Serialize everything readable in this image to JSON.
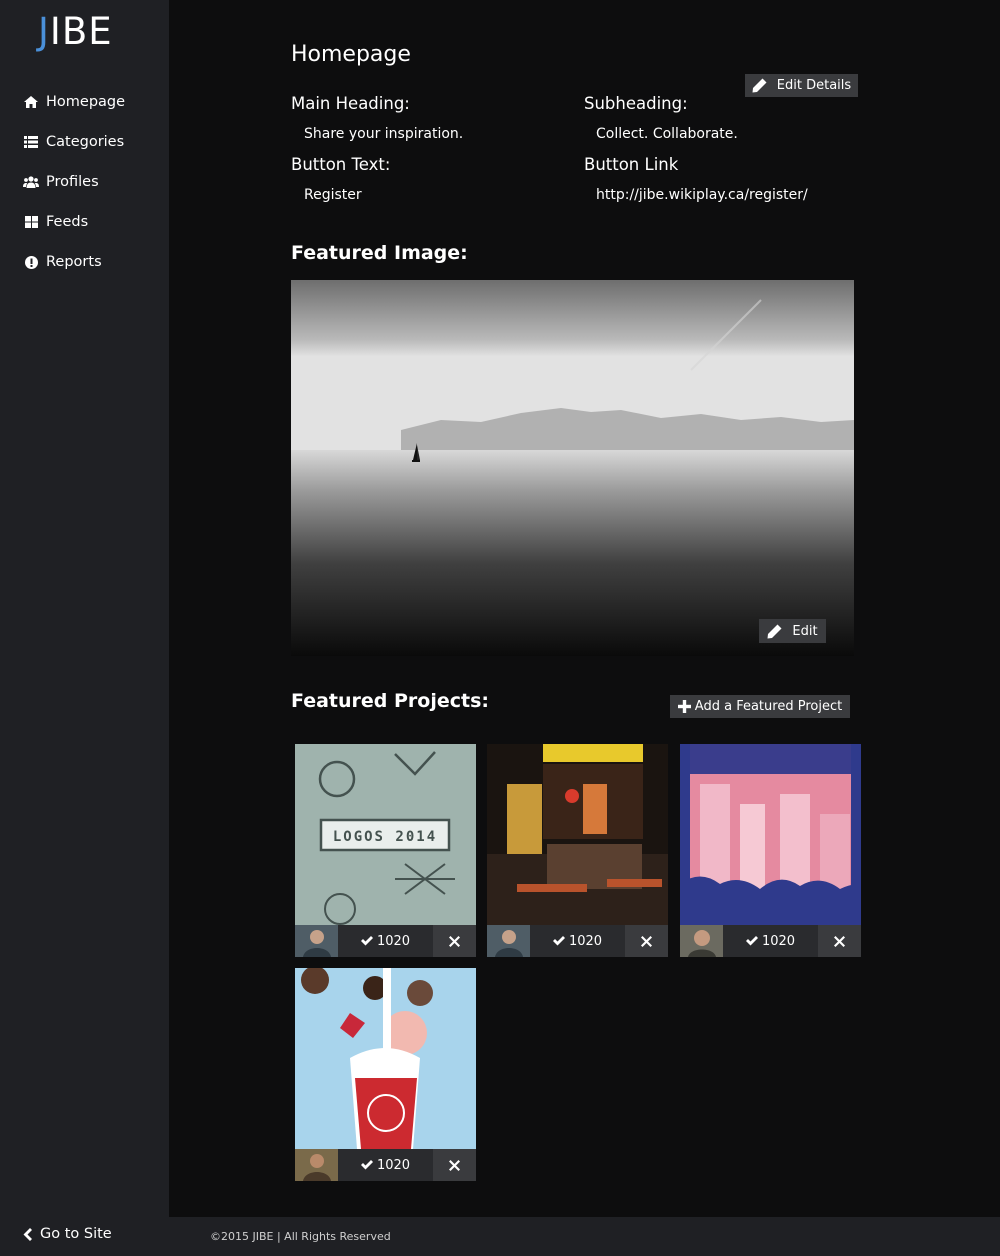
{
  "brand": {
    "logo_first": "J",
    "logo_rest": "IBE"
  },
  "sidebar": {
    "items": [
      {
        "label": "Homepage",
        "icon": "home-icon"
      },
      {
        "label": "Categories",
        "icon": "list-icon"
      },
      {
        "label": "Profiles",
        "icon": "users-icon"
      },
      {
        "label": "Feeds",
        "icon": "grid-icon"
      },
      {
        "label": "Reports",
        "icon": "exclamation-icon"
      }
    ],
    "go_to_site": "Go to Site"
  },
  "main": {
    "title": "Homepage",
    "edit_details_label": "Edit Details",
    "fields": {
      "main_heading_label": "Main Heading:",
      "main_heading_value": "Share your inspiration.",
      "subheading_label": "Subheading:",
      "subheading_value": "Collect. Collaborate.",
      "button_text_label": "Button Text:",
      "button_text_value": "Register",
      "button_link_label": "Button Link",
      "button_link_value": "http://jibe.wikiplay.ca/register/"
    },
    "featured_image_title": "Featured Image:",
    "edit_image_label": "Edit",
    "featured_projects_title": "Featured Projects:",
    "add_project_label": "Add a Featured Project",
    "projects": [
      {
        "thumb_text": "LOGOS 2014",
        "likes": "1020"
      },
      {
        "likes": "1020"
      },
      {
        "likes": "1020"
      },
      {
        "likes": "1020"
      }
    ]
  },
  "footer": {
    "text": "©2015 JIBE | All Rights Reserved"
  },
  "colors": {
    "sidebar_bg": "#1f2024",
    "page_bg": "#0d0d0e",
    "button_bg": "#3a3b3e",
    "accent": "#4a90d9"
  }
}
